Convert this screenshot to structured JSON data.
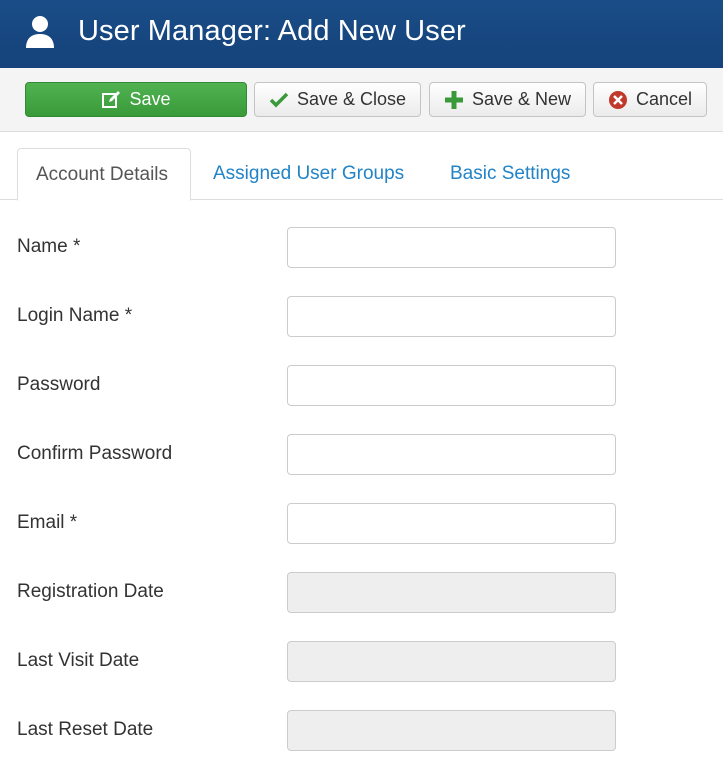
{
  "header": {
    "title": "User Manager: Add New User",
    "icon": "user-icon"
  },
  "toolbar": {
    "save_label": "Save",
    "save_close_label": "Save & Close",
    "save_new_label": "Save & New",
    "cancel_label": "Cancel"
  },
  "tabs": [
    {
      "label": "Account Details",
      "active": true
    },
    {
      "label": "Assigned User Groups",
      "active": false
    },
    {
      "label": "Basic Settings",
      "active": false
    }
  ],
  "form": {
    "fields": [
      {
        "label": "Name *",
        "value": "",
        "disabled": false
      },
      {
        "label": "Login Name *",
        "value": "",
        "disabled": false
      },
      {
        "label": "Password",
        "value": "",
        "disabled": false
      },
      {
        "label": "Confirm Password",
        "value": "",
        "disabled": false
      },
      {
        "label": "Email *",
        "value": "",
        "disabled": false
      },
      {
        "label": "Registration Date",
        "value": "",
        "disabled": true
      },
      {
        "label": "Last Visit Date",
        "value": "",
        "disabled": true
      },
      {
        "label": "Last Reset Date",
        "value": "",
        "disabled": true
      }
    ]
  },
  "colors": {
    "header_bg": "#1a4d87",
    "save_button": "#45a845",
    "link": "#2283c7",
    "cancel_icon": "#c0392b",
    "check_icon": "#3a9a3a"
  }
}
